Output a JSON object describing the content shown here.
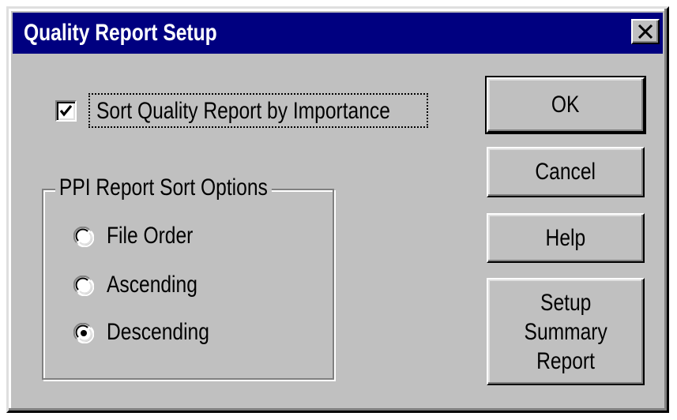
{
  "window": {
    "title": "Quality Report Setup",
    "close_icon": "close-icon"
  },
  "checkbox": {
    "label": "Sort Quality Report by Importance",
    "checked": true
  },
  "sort_options": {
    "group_label": "PPI Report Sort Options",
    "options": [
      {
        "label": "File Order",
        "selected": false
      },
      {
        "label": "Ascending",
        "selected": false
      },
      {
        "label": "Descending",
        "selected": true
      }
    ]
  },
  "buttons": {
    "ok": "OK",
    "cancel": "Cancel",
    "help": "Help",
    "setup_summary": [
      "Setup",
      "Summary",
      "Report"
    ]
  }
}
